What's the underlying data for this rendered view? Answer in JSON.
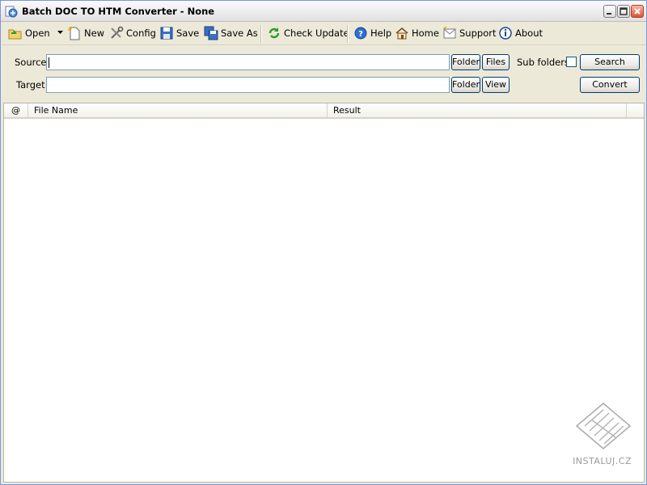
{
  "window": {
    "title": "Batch DOC TO HTM Converter - None"
  },
  "toolbar": {
    "open": "Open",
    "new": "New",
    "config": "Config",
    "save": "Save",
    "save_as": "Save As",
    "check_update": "Check Update",
    "help": "Help",
    "home": "Home",
    "support": "Support",
    "about": "About"
  },
  "form": {
    "source_label": "Source",
    "source_value": "",
    "target_label": "Target",
    "target_value": "",
    "folder_label": "Folder",
    "files_label": "Files",
    "view_label": "View",
    "subfolders_label": "Sub folders",
    "subfolders_checked": false,
    "search_label": "Search",
    "convert_label": "Convert"
  },
  "list": {
    "columns": [
      "@",
      "File Name",
      "Result"
    ],
    "rows": []
  },
  "watermark": {
    "text": "INSTALUJ.CZ"
  },
  "colors": {
    "window_bg": "#ece9d8",
    "button_border": "#003c74",
    "field_border": "#7f9db9"
  }
}
